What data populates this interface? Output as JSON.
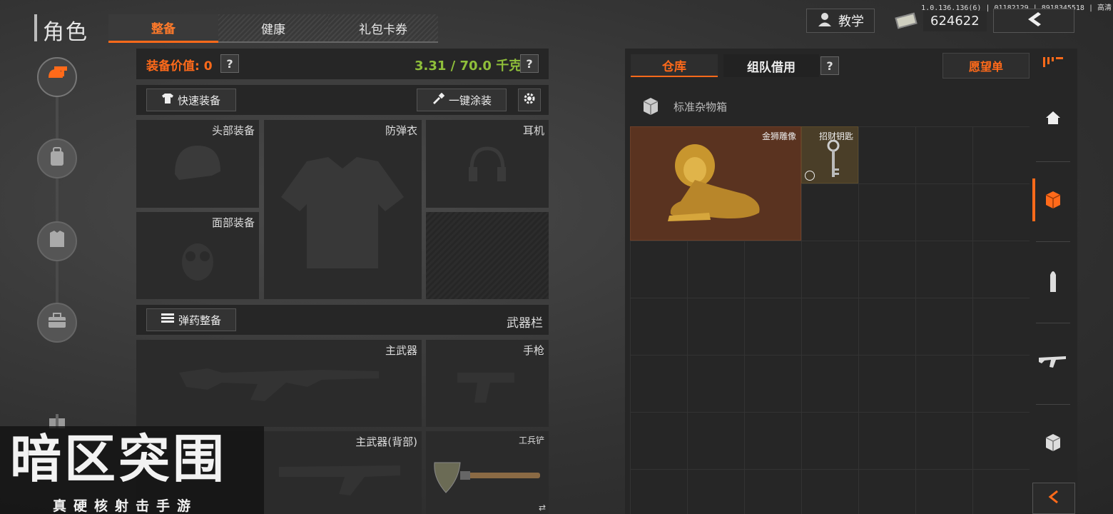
{
  "version": "1.0.136.136(6) | 01182129 | 8918345518 | 高清",
  "header": {
    "title": "角色",
    "tabs": [
      {
        "label": "整备",
        "active": true
      },
      {
        "label": "健康",
        "active": false
      },
      {
        "label": "礼包卡券",
        "active": false
      }
    ],
    "tutorial_label": "教学",
    "money": "624622"
  },
  "sidebar": {
    "items": [
      {
        "icon": "helmet-gun-icon",
        "active": true
      },
      {
        "icon": "backpack-icon",
        "active": false
      },
      {
        "icon": "armor-icon",
        "active": false
      },
      {
        "icon": "toolbox-icon",
        "active": false
      }
    ]
  },
  "equipment": {
    "value_label": "装备价值: 0",
    "weight": "3.31 / 70.0 千克",
    "quick_equip": "快速装备",
    "one_click_paint": "一键涂装",
    "ammo_equip": "弹药整备",
    "weapon_bar": "武器栏",
    "slots": {
      "head": "头部装备",
      "vest": "防弹衣",
      "ear": "耳机",
      "face": "面部装备",
      "primary": "主武器",
      "pistol": "手枪",
      "primary_back": "主武器(背部)",
      "shovel": "工兵铲"
    }
  },
  "storage": {
    "tab_warehouse": "仓库",
    "tab_team_borrow": "组队借用",
    "wishlist": "愿望单",
    "container_name": "标准杂物箱",
    "items": [
      {
        "name": "金狮雕像"
      },
      {
        "name": "招财钥匙"
      }
    ]
  },
  "logo": {
    "title": "暗区突围",
    "subtitle": "真硬核射击手游"
  },
  "colors": {
    "accent": "#ff6a1a",
    "weight_green": "#8fbf3a",
    "lion_bg": "#5a3320"
  }
}
